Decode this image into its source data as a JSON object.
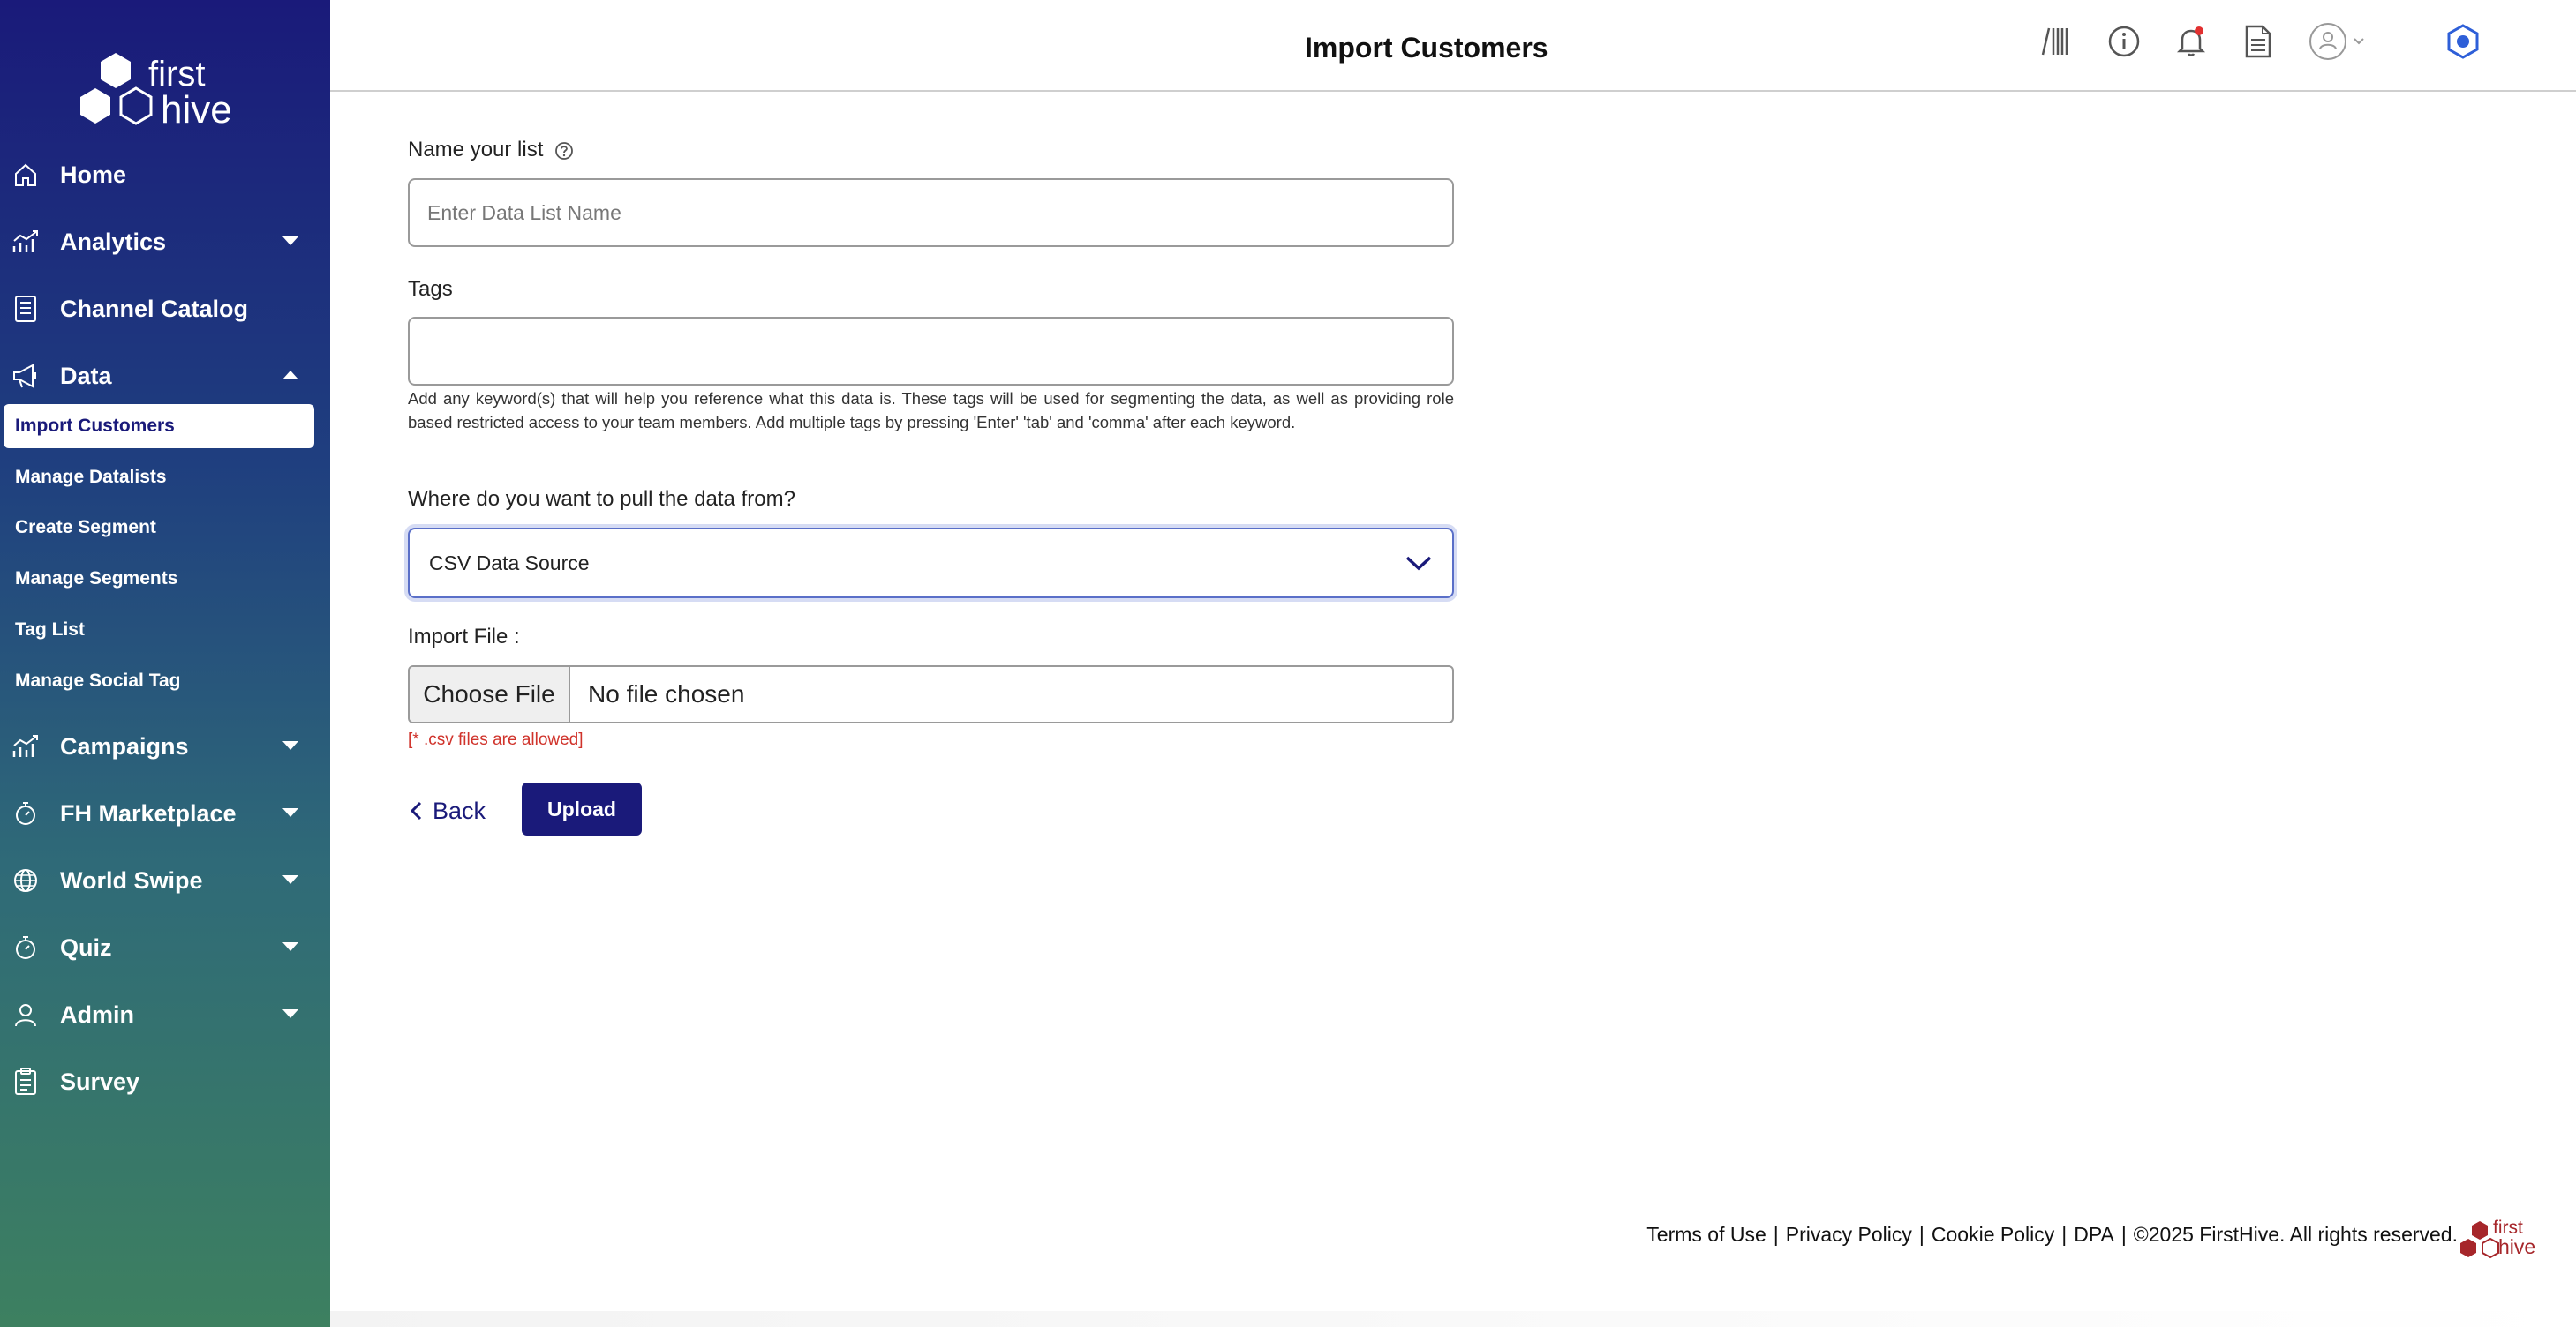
{
  "brand": {
    "logo_word1": "first",
    "logo_word2": "hive",
    "primary_color": "#1a1a7a",
    "accent_red": "#d0332b"
  },
  "sidebar": {
    "items": [
      {
        "label": "Home",
        "icon": "home-icon"
      },
      {
        "label": "Analytics",
        "icon": "analytics-icon"
      },
      {
        "label": "Channel Catalog",
        "icon": "catalog-icon"
      },
      {
        "label": "Data",
        "icon": "megaphone-icon"
      },
      {
        "label": "Campaigns",
        "icon": "campaigns-icon"
      },
      {
        "label": "FH Marketplace",
        "icon": "stopwatch-icon"
      },
      {
        "label": "World Swipe",
        "icon": "globe-icon"
      },
      {
        "label": "Quiz",
        "icon": "quiz-icon"
      },
      {
        "label": "Admin",
        "icon": "user-icon"
      },
      {
        "label": "Survey",
        "icon": "clipboard-icon"
      }
    ],
    "data_sub": [
      "Import Customers",
      "Manage Datalists",
      "Create Segment",
      "Manage Segments",
      "Tag List",
      "Manage Social Tag"
    ]
  },
  "header": {
    "title": "Import Customers"
  },
  "form": {
    "name_label": "Name your list",
    "name_placeholder": "Enter Data List Name",
    "tags_label": "Tags",
    "tags_help": "Add any keyword(s) that will help you reference what this data is. These tags will be used for segmenting the data, as well as providing role based restricted access to your team members. Add multiple tags by pressing 'Enter' 'tab' and 'comma' after each keyword.",
    "source_label": "Where do you want to pull the data from?",
    "source_value": "CSV Data Source",
    "file_label": "Import File :",
    "choose_file": "Choose File",
    "file_status": "No file chosen",
    "file_note": "[* .csv files are allowed]",
    "back": "Back",
    "upload": "Upload"
  },
  "footer": {
    "terms": "Terms of Use",
    "privacy": "Privacy Policy",
    "cookie": "Cookie Policy",
    "dpa": "DPA",
    "copyright": "©2025 FirstHive. All rights reserved.",
    "sep": "|",
    "logo_word1": "first",
    "logo_word2": "hive"
  }
}
